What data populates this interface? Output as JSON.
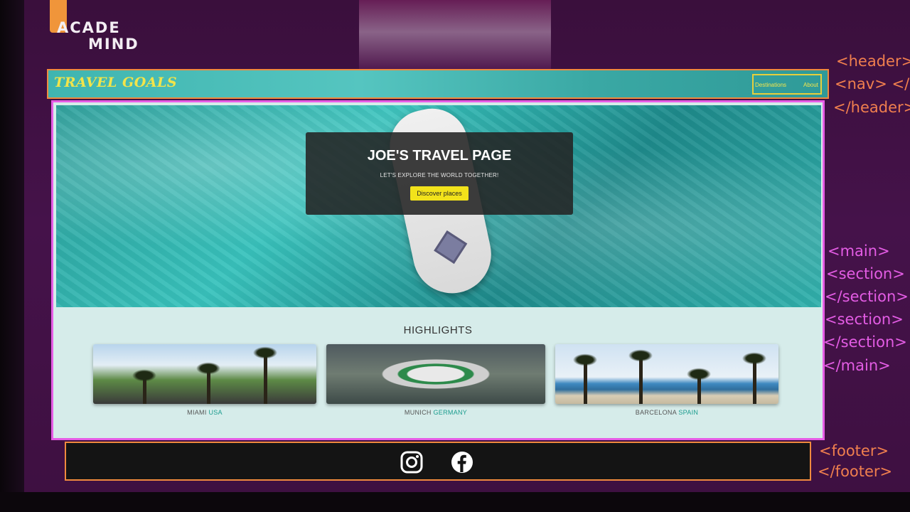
{
  "logo": {
    "line1": "ACADE",
    "line2": "MIND"
  },
  "site": {
    "brand": "TRAVEL GOALS",
    "nav": [
      "Destinations",
      "About"
    ],
    "hero": {
      "title": "JOE'S TRAVEL PAGE",
      "subtitle": "LET'S EXPLORE THE WORLD TOGETHER!",
      "cta": "Discover places"
    },
    "highlights": {
      "title": "HIGHLIGHTS",
      "items": [
        {
          "city": "MIAMI",
          "country": "USA"
        },
        {
          "city": "MUNICH",
          "country": "GERMANY"
        },
        {
          "city": "BARCELONA",
          "country": "SPAIN"
        }
      ]
    },
    "footer": {
      "icons": [
        "instagram-icon",
        "facebook-icon"
      ]
    }
  },
  "tags": {
    "header_open": "<header>",
    "nav": "<nav> </n",
    "header_close": "</header>",
    "main_open": "<main>",
    "section_open_1": "<section>",
    "section_close_1": "</section>",
    "section_open_2": "<section>",
    "section_close_2": "</section>",
    "main_close": "</main>",
    "footer_open": "<footer>",
    "footer_close": "</footer>"
  },
  "colors": {
    "header_border": "#f08a3e",
    "main_border": "#e65de6",
    "brand_text": "#f2e44a",
    "cta_bg": "#f2e21b",
    "country_text": "#1a9c8e"
  }
}
